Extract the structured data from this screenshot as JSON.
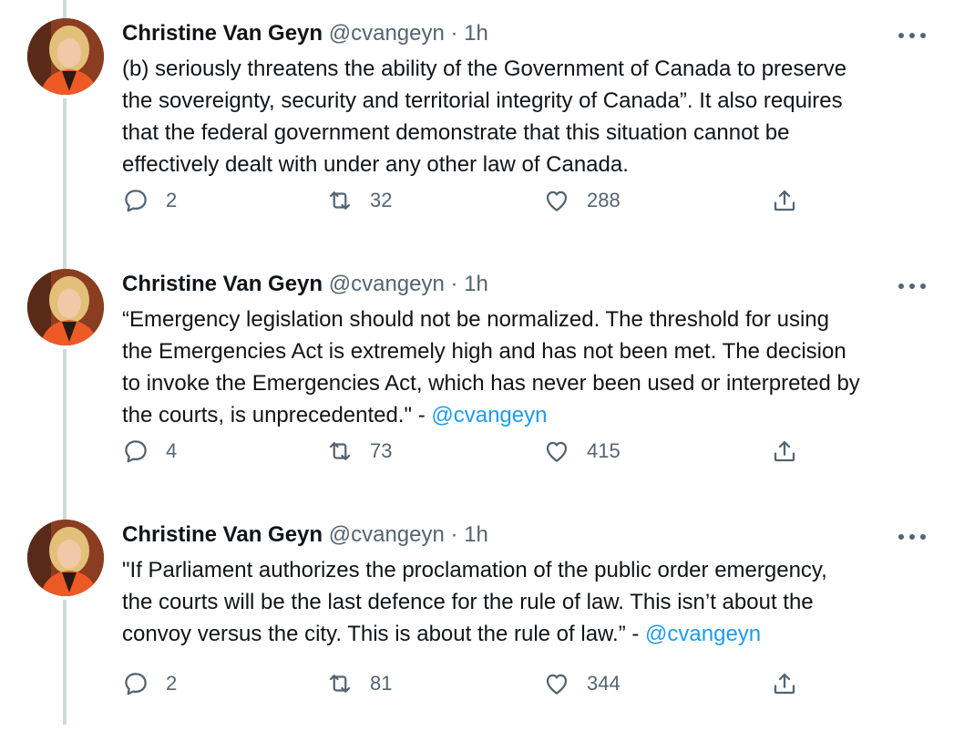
{
  "tweets": [
    {
      "author_name": "Christine Van Geyn",
      "handle": "@cvangeyn",
      "separator": "·",
      "time": "1h",
      "lines": [
        "(b) seriously threatens the ability of the Government of Canada to preserve",
        "the sovereignty, security and territorial integrity of Canada”. It also requires",
        "that the federal government demonstrate that this situation cannot be",
        "effectively dealt with under any other law of Canada."
      ],
      "mention": "",
      "replies": "2",
      "retweets": "32",
      "likes": "288"
    },
    {
      "author_name": "Christine Van Geyn",
      "handle": "@cvangeyn",
      "separator": "·",
      "time": "1h",
      "lines": [
        "“Emergency legislation should not be normalized. The threshold for using",
        "the Emergencies Act is extremely high and has not been met. The decision",
        "to invoke the Emergencies Act, which has never been used or interpreted by",
        "the courts, is unprecedented.\" - "
      ],
      "mention": "@cvangeyn",
      "replies": "4",
      "retweets": "73",
      "likes": "415"
    },
    {
      "author_name": "Christine Van Geyn",
      "handle": "@cvangeyn",
      "separator": "·",
      "time": "1h",
      "lines": [
        "\"If Parliament authorizes the proclamation of the public order emergency,",
        "the courts will be the last defence for the rule of law. This isn’t about the",
        "convoy versus the city. This is about the rule of law.” - "
      ],
      "mention": "@cvangeyn",
      "replies": "2",
      "retweets": "81",
      "likes": "344"
    }
  ],
  "icons": {
    "reply": "reply-icon",
    "retweet": "retweet-icon",
    "like": "heart-icon",
    "share": "share-icon",
    "more": "more-icon"
  },
  "colors": {
    "text": "#0f1419",
    "secondary": "#536471",
    "link": "#1d9bf0",
    "thread_line": "#cfd9de"
  }
}
